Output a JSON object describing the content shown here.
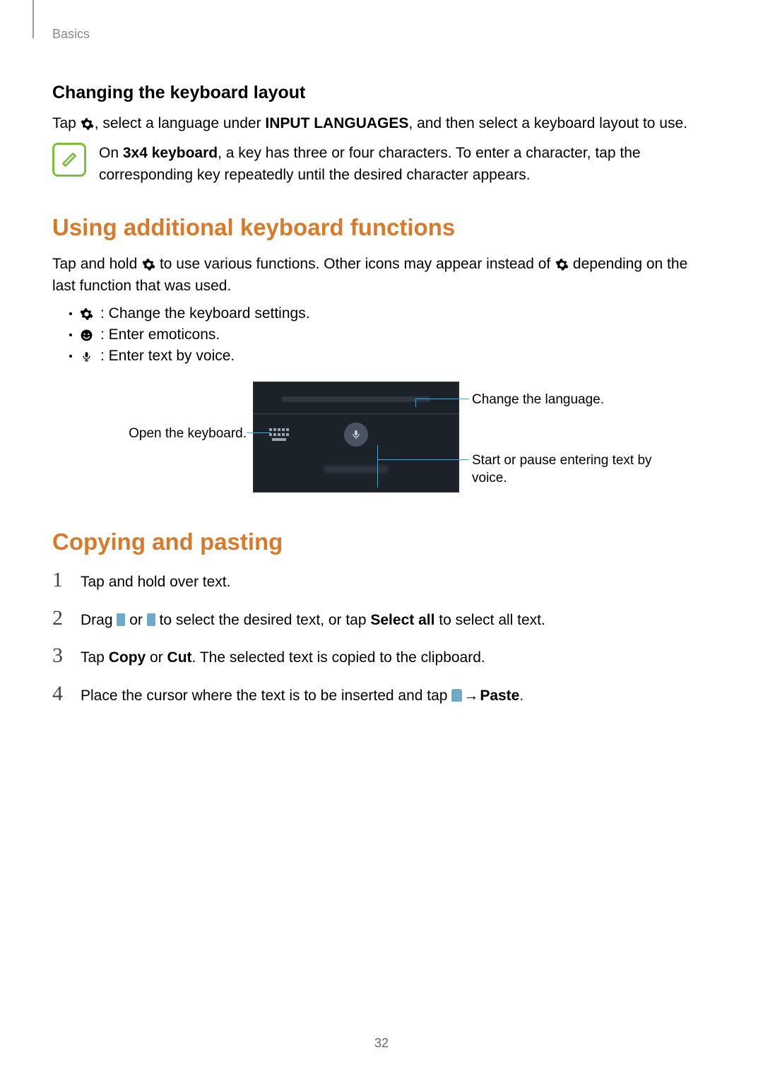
{
  "header": {
    "section": "Basics"
  },
  "section1": {
    "heading": "Changing the keyboard layout",
    "para_pre": "Tap ",
    "para_mid": ", select a language under ",
    "para_bold": "INPUT LANGUAGES",
    "para_post": ", and then select a keyboard layout to use.",
    "note_pre": "On ",
    "note_bold": "3x4 keyboard",
    "note_post": ", a key has three or four characters. To enter a character, tap the corresponding key repeatedly until the desired character appears."
  },
  "section2": {
    "heading": "Using additional keyboard functions",
    "intro_pre": "Tap and hold ",
    "intro_mid": " to use various functions. Other icons may appear instead of ",
    "intro_post": " depending on the last function that was used.",
    "bullet1": " : Change the keyboard settings.",
    "bullet2": " : Enter emoticons.",
    "bullet3": " : Enter text by voice.",
    "callout_left": "Open the keyboard.",
    "callout_right_top": "Change the language.",
    "callout_right_bot": "Start or pause entering text by voice."
  },
  "section3": {
    "heading": "Copying and pasting",
    "step1": "Tap and hold over text.",
    "step2_pre": "Drag ",
    "step2_mid1": " or ",
    "step2_mid2": " to select the desired text, or tap ",
    "step2_bold": "Select all",
    "step2_post": " to select all text.",
    "step3_pre": "Tap ",
    "step3_b1": "Copy",
    "step3_mid": " or ",
    "step3_b2": "Cut",
    "step3_post": ". The selected text is copied to the clipboard.",
    "step4_pre": "Place the cursor where the text is to be inserted and tap ",
    "step4_arrow": " → ",
    "step4_bold": "Paste",
    "step4_post": "."
  },
  "page_number": "32",
  "step_numbers": [
    "1",
    "2",
    "3",
    "4"
  ]
}
